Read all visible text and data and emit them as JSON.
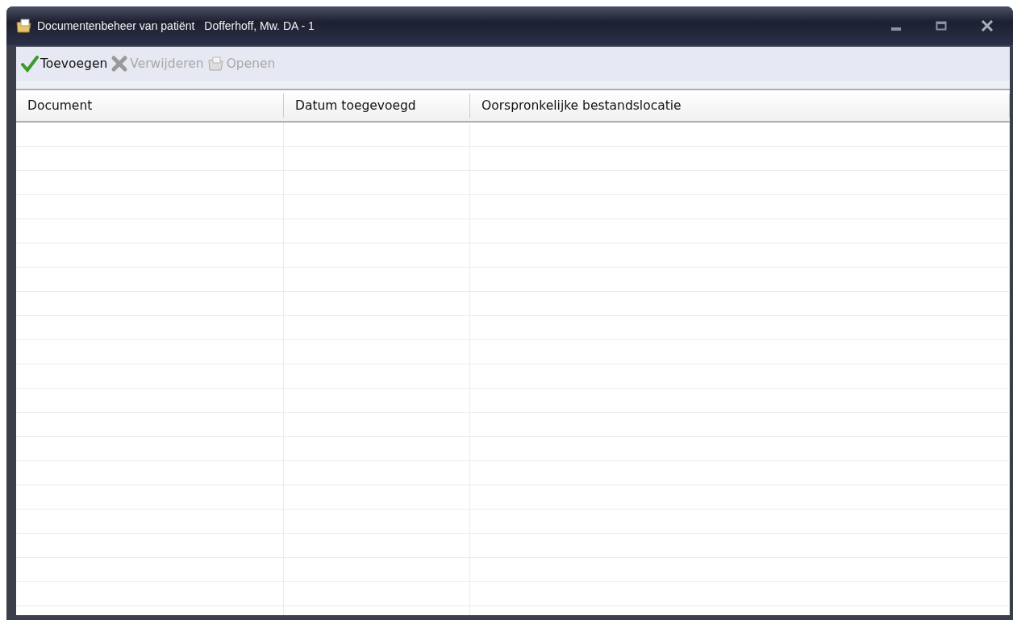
{
  "window": {
    "title": "Documentenbeheer van patiënt",
    "subtitle": "Dofferhoff, Mw. DA - 1"
  },
  "toolbar": [
    {
      "kind": "add",
      "label": "Toevoegen",
      "disabled": false
    },
    {
      "kind": "delete",
      "label": "Verwijderen",
      "disabled": true
    },
    {
      "kind": "open",
      "label": "Openen",
      "disabled": true
    }
  ],
  "table": {
    "columns": [
      "Document",
      "Datum toegevoegd",
      "Oorspronkelijke bestandslocatie"
    ]
  }
}
